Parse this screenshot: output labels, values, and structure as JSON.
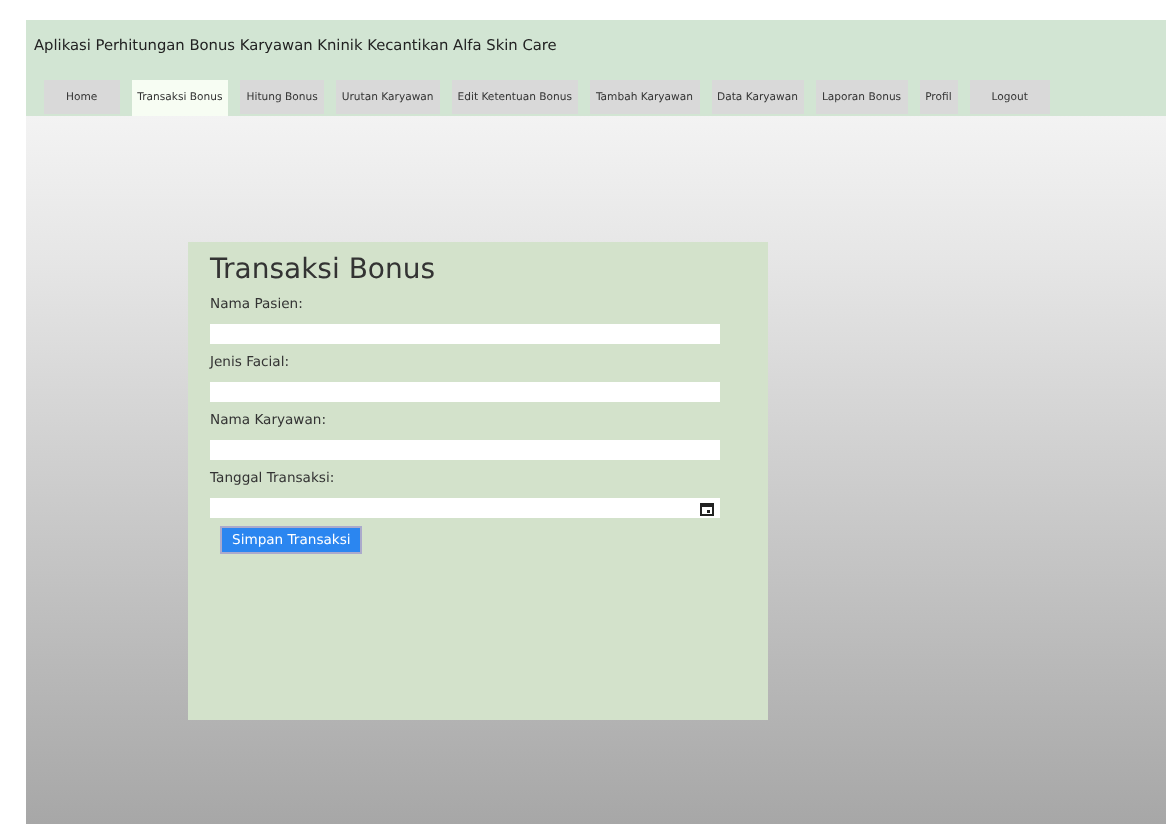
{
  "header": {
    "title": "Aplikasi Perhitungan Bonus Karyawan Kninik Kecantikan Alfa Skin Care"
  },
  "tabs": [
    {
      "label": "Home",
      "selected": false
    },
    {
      "label": "Transaksi Bonus",
      "selected": true
    },
    {
      "label": "Hitung Bonus",
      "selected": false
    },
    {
      "label": "Urutan Karyawan",
      "selected": false
    },
    {
      "label": "Edit Ketentuan Bonus",
      "selected": false
    },
    {
      "label": "Tambah Karyawan",
      "selected": false
    },
    {
      "label": "Data Karyawan",
      "selected": false
    },
    {
      "label": "Laporan Bonus",
      "selected": false
    },
    {
      "label": "Profil",
      "selected": false
    },
    {
      "label": "Logout",
      "selected": false
    }
  ],
  "form": {
    "title": "Transaksi Bonus",
    "fields": [
      {
        "label": "Nama Pasien:",
        "kind": "text"
      },
      {
        "label": "Jenis Facial:",
        "kind": "text"
      },
      {
        "label": "Nama Karyawan:",
        "kind": "text"
      },
      {
        "label": "Tanggal Transaksi:",
        "kind": "date"
      }
    ],
    "submit": "Simpan Transaksi"
  }
}
